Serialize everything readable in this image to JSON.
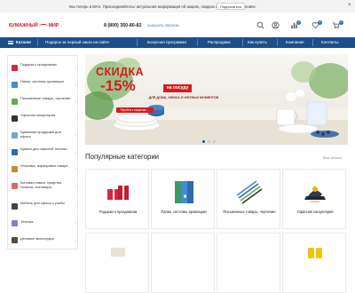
{
  "topbar": {
    "message": "Мы теперь в MAX. Присоединяйтесь! актуальная информация об акциях, скидках и новых поступлениях.",
    "subscribe_label": "Подписаться",
    "close_glyph": "×"
  },
  "header": {
    "logo_left": "БУМАЖНЫЙ",
    "logo_right": "МИР",
    "phone": "8 (800) 350-80-82",
    "callback_label": "ЗАКАЗАТЬ ЗВОНОК",
    "badges": {
      "compare": "0",
      "favorites": "0",
      "cart": "0"
    },
    "icons": [
      "search-icon",
      "user-icon",
      "compare-icon",
      "heart-icon",
      "cart-icon"
    ]
  },
  "nav": {
    "catalog_label": "Каталог",
    "items": [
      "Подарок за первый заказ на сайте",
      "Бонусная программа",
      "Распродажа",
      "Как купить",
      "Компания",
      "Контакты"
    ]
  },
  "sidebar": {
    "items": [
      {
        "label": "Подарки к праздникам",
        "color": "#d7263d"
      },
      {
        "label": "Папки, системы архивации",
        "color": "#3f8ed6"
      },
      {
        "label": "Письменные товары, черчение",
        "color": "#6aa84f"
      },
      {
        "label": "Офисная канцелярия",
        "color": "#333333"
      },
      {
        "label": "Бумажная продукция для офиса",
        "color": "#7aa6c2"
      },
      {
        "label": "Бумага для офисной техники",
        "color": "#2d6bb2"
      },
      {
        "label": "Упаковка, маркировка товара",
        "color": "#c98b3f"
      },
      {
        "label": "Бытовая химия, средства гигиены, хозтовары",
        "color": "#e06666"
      },
      {
        "label": "Мебель для офиса и учебы",
        "color": "#444444"
      },
      {
        "label": "Техника",
        "color": "#8e7cc3"
      },
      {
        "label": "Деловые аксессуары",
        "color": "#5b4a3a"
      }
    ],
    "arrow_glyph": "›"
  },
  "banner": {
    "title_line1": "СКИДКА",
    "title_line2": "-15%",
    "tag": "на посуду",
    "subtitle": "ДЛЯ ДОМА, ОФИСА И УЮТНЫХ МОМЕНТОВ",
    "button_label": "Перейти к покупкам →",
    "slides_total": 3,
    "active_slide": 1
  },
  "categories": {
    "title": "Популярные категории",
    "all_link": "Весь каталог",
    "items": [
      {
        "label": "Подарки к праздникам"
      },
      {
        "label": "Папки, системы архивации"
      },
      {
        "label": "Письменные товары, черчение"
      },
      {
        "label": "Офисная канцелярия"
      }
    ]
  },
  "colors": {
    "brand_red": "#d61b22",
    "nav_blue": "#1b4f8a",
    "badge_blue": "#2c6fae"
  }
}
